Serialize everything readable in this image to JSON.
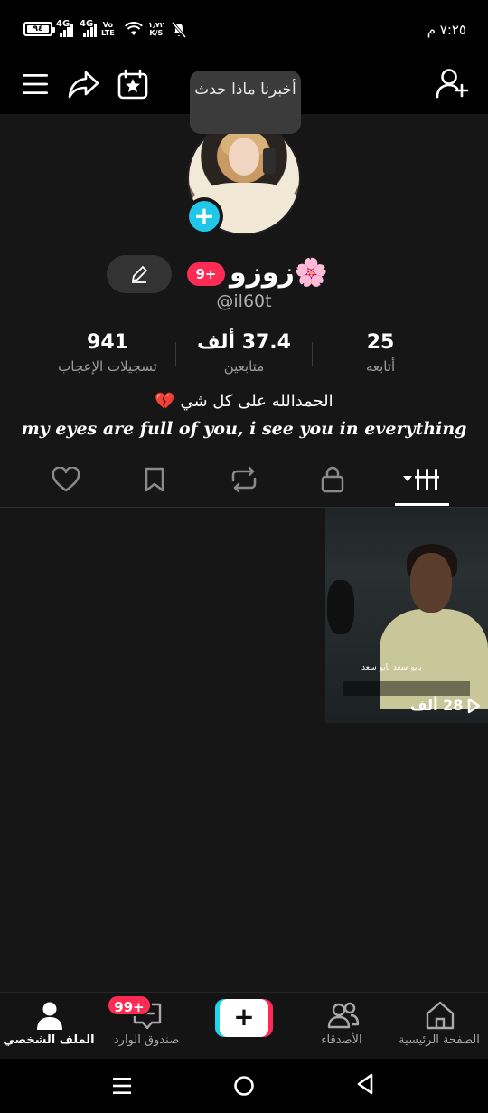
{
  "status_bar": {
    "battery": "٩٤",
    "network1": "4G",
    "network2": "4G",
    "volte_top": "Vo",
    "volte_bottom": "LTE",
    "speed_top": "١٫٧٢",
    "speed_bottom": "K/S",
    "time": "٧:٢٥ م"
  },
  "tooltip": {
    "text": "أخبرنا ماذا حدث"
  },
  "profile": {
    "notification_badge": "9+",
    "username": "زوزو🌸",
    "handle": "@il60t"
  },
  "stats": [
    {
      "value": "25",
      "label": "أتابعه"
    },
    {
      "value": "37.4 ألف",
      "label": "متابعين"
    },
    {
      "value": "941",
      "label": "تسجيلات الإعجاب"
    }
  ],
  "bio": {
    "line1": "الحمدالله على كل شي 💔",
    "line2": "my eyes are full of you, i see you in everything"
  },
  "tabs": [
    "videos",
    "private",
    "reposts",
    "favorites",
    "liked"
  ],
  "video": {
    "views": "28 ألف",
    "caption": "بابو سعد بابو سعد"
  },
  "bottom_nav": {
    "home": "الصفحة الرئيسية",
    "friends": "الأصدقاء",
    "create": "+",
    "inbox": "صندوق الوارد",
    "inbox_badge": "99+",
    "profile": "الملف الشخصي"
  },
  "colors": {
    "accent_pink": "#fe2c55",
    "accent_cyan": "#20d5ec",
    "background": "#161616"
  }
}
